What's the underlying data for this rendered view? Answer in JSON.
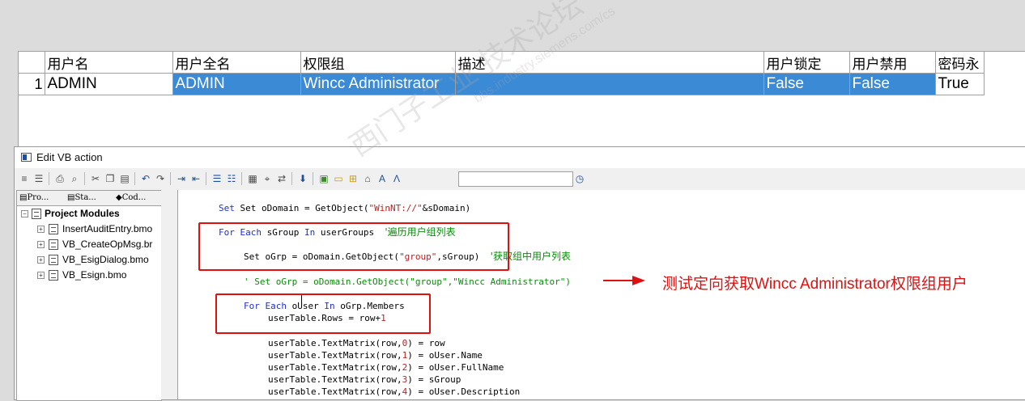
{
  "user_table": {
    "columns": [
      "",
      "用户名",
      "用户全名",
      "权限组",
      "描述",
      "用户锁定",
      "用户禁用",
      "密码永"
    ],
    "rows": [
      {
        "num": "1",
        "username": "ADMIN",
        "fullname": "ADMIN",
        "group": "Wincc Administrator",
        "description": "",
        "locked": "False",
        "disabled": "False",
        "pwd": "True"
      }
    ]
  },
  "editor": {
    "title": "Edit VB action",
    "tabs": [
      "Pro...",
      "Sta...",
      "Cod..."
    ],
    "tree": {
      "root": "Project Modules",
      "items": [
        "InsertAuditEntry.bmo",
        "VB_CreateOpMsg.br",
        "VB_EsigDialog.bmo",
        "VB_Esign.bmo"
      ]
    },
    "toolbar_icons": [
      "list-icon",
      "align-icon",
      "print-icon",
      "print-preview-icon",
      "cut-icon",
      "copy-icon",
      "paste-icon",
      "undo-icon",
      "redo-icon",
      "indent-icon",
      "outdent-icon",
      "comment-icon",
      "uncomment-icon",
      "bookmark-icon",
      "find-icon",
      "replace-icon",
      "syntax-check-icon",
      "tag-icon",
      "open-icon",
      "dialog-icon",
      "function-icon",
      "font-icon",
      "info-icon"
    ],
    "code": {
      "l1_a": "Set oDomain = GetObject(",
      "l1_str": "\"WinNT://\"",
      "l1_b": "&sDomain)",
      "l2_kw1": "For Each",
      "l2_a": " sGroup ",
      "l2_kw2": "In",
      "l2_b": " userGroups",
      "l2_cm": "'遍历用户组列表",
      "l3_a": "Set oGrp = oDomain.GetObject(",
      "l3_str": "\"group\"",
      "l3_b": ",sGroup)",
      "l3_cm": "'获取组中用户列表",
      "l4": "' Set oGrp = oDomain.GetObject(\"group\",\"Wincc Administrator\")",
      "l5_kw1": "For Each",
      "l5_a": " oUser ",
      "l5_kw2": "In",
      "l5_b": " oGrp.Members",
      "l6_a": "userTable.Rows = row+",
      "l6_num": "1",
      "l7_a": "userTable.TextMatrix(row,",
      "l7_num": "0",
      "l7_b": ") = row",
      "l8_a": "userTable.TextMatrix(row,",
      "l8_num": "1",
      "l8_b": ") = oUser.Name",
      "l9_a": "userTable.TextMatrix(row,",
      "l9_num": "2",
      "l9_b": ") = oUser.FullName",
      "l10_a": "userTable.TextMatrix(row,",
      "l10_num": "3",
      "l10_b": ") = sGroup",
      "l11_a": "userTable.TextMatrix(row,",
      "l11_num": "4",
      "l11_b": ") = oUser.Description"
    }
  },
  "annotation": "测试定向获取Wincc Administrator权限组用户",
  "watermark": {
    "main": "西门子工业 技术论坛",
    "sub": "bbs.industry.siemens.com/cs"
  },
  "colors": {
    "selection": "#3a8ad6",
    "keyword": "#1f2fd0",
    "string": "#c02020",
    "comment": "#0a8a0a",
    "annotation": "#e01010"
  }
}
